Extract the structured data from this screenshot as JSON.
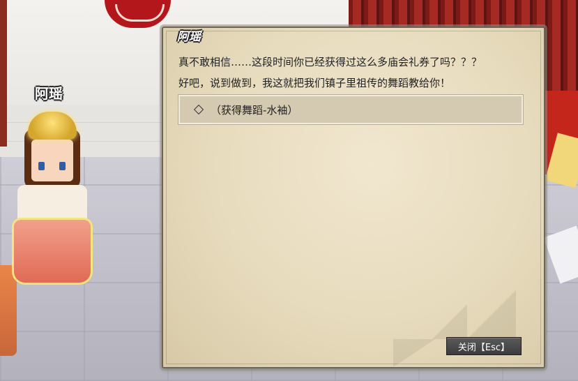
{
  "npc": {
    "name": "阿瑶"
  },
  "dialog": {
    "speaker": "阿瑶",
    "lines": [
      "真不敢相信……这段时间你已经获得过这么多庙会礼券了吗？？？",
      "好吧，说到做到，我这就把我们镇子里祖传的舞蹈教给你！"
    ],
    "options": [
      {
        "label": "（获得舞蹈-水袖）",
        "icon": "diamond-icon"
      }
    ],
    "close_label": "关闭【Esc】"
  },
  "colors": {
    "parchment": "#e9ddc0",
    "option_bg": "#d4c9b1",
    "button_bg": "#474747",
    "text": "#222222"
  }
}
